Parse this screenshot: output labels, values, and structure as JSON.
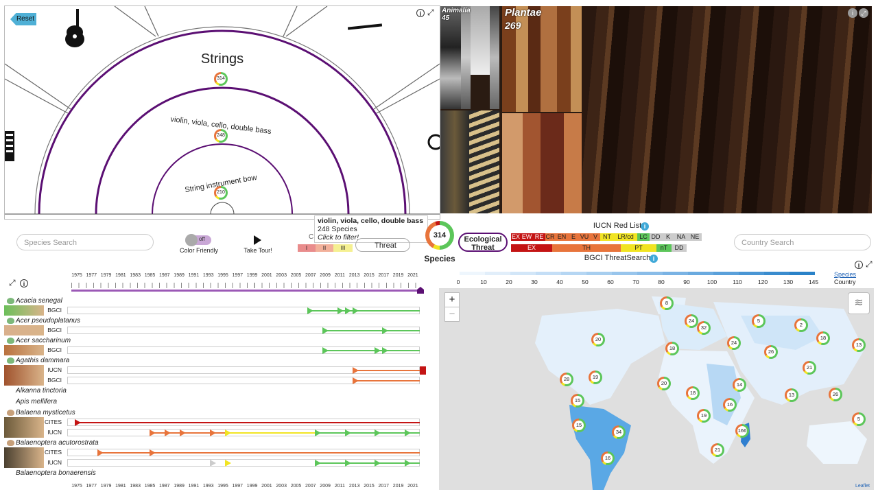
{
  "instrument_panel": {
    "reset_label": "Reset",
    "title": "Strings",
    "ring_outer_label": "violin, viola, cello, double bass",
    "ring_inner_label": "String instrument bow",
    "badge_outer": "314",
    "badge_mid": "248",
    "badge_inner": "210",
    "info_label": "i",
    "expand_label": "⤢"
  },
  "taxonomy": {
    "animalia_label": "Animalia",
    "animalia_count": "45",
    "plantae_label": "Plantae",
    "plantae_count": "269"
  },
  "tooltip": {
    "title": "violin, viola, cello, double bass",
    "count": "248 Species",
    "hint": "Click to filter!"
  },
  "controls": {
    "species_search_placeholder": "Species Search",
    "country_search_placeholder": "Country Search",
    "toggle_label": "off",
    "color_friendly_label": "Color Friendly",
    "take_tour_label": "Take Tour!",
    "threat_label": "Threat",
    "c_label": "C",
    "cites_cells": [
      "I",
      "II",
      "III"
    ],
    "species_total": "314",
    "species_label": "Species",
    "ecological_threat_label": "Ecological Threat",
    "iucn_title": "IUCN Red List",
    "bgci_title": "BGCI ThreatSearch",
    "iucn_cells": [
      {
        "t": "EX",
        "c": "#c41414"
      },
      {
        "t": "EW",
        "c": "#c41414"
      },
      {
        "t": "RE",
        "c": "#c41414"
      },
      {
        "t": "CR",
        "c": "#e8743b"
      },
      {
        "t": "EN",
        "c": "#e8743b"
      },
      {
        "t": "E",
        "c": "#e8743b"
      },
      {
        "t": "VU",
        "c": "#e8743b"
      },
      {
        "t": "V",
        "c": "#e8743b"
      },
      {
        "t": "NT",
        "c": "#f1e422"
      },
      {
        "t": "LR/cd",
        "c": "#f1e422"
      },
      {
        "t": "LC",
        "c": "#5cc65a"
      },
      {
        "t": "DD",
        "c": "#ccc"
      },
      {
        "t": "K",
        "c": "#ccc"
      },
      {
        "t": "NA",
        "c": "#ccc"
      },
      {
        "t": "NE",
        "c": "#ccc"
      }
    ],
    "bgci_cells": [
      {
        "t": "EX",
        "c": "#c41414"
      },
      {
        "t": "TH",
        "c": "#e8743b"
      },
      {
        "t": "PT",
        "c": "#f1e422"
      },
      {
        "t": "nT",
        "c": "#5cc65a"
      },
      {
        "t": "DD",
        "c": "#ccc"
      }
    ]
  },
  "map_legend": {
    "ticks": [
      "0",
      "10",
      "20",
      "30",
      "40",
      "50",
      "60",
      "70",
      "80",
      "90",
      "100",
      "110",
      "120",
      "130",
      "145"
    ],
    "species_label": "Species",
    "country_label": "Country",
    "attribution": "Leaflet",
    "zoom_in": "+",
    "zoom_out": "−"
  },
  "map_clusters": [
    {
      "n": "8"
    },
    {
      "n": "24"
    },
    {
      "n": "32"
    },
    {
      "n": "5"
    },
    {
      "n": "2"
    },
    {
      "n": "20"
    },
    {
      "n": "18"
    },
    {
      "n": "13"
    },
    {
      "n": "24"
    },
    {
      "n": "18"
    },
    {
      "n": "26"
    },
    {
      "n": "21"
    },
    {
      "n": "28"
    },
    {
      "n": "19"
    },
    {
      "n": "20"
    },
    {
      "n": "18"
    },
    {
      "n": "14"
    },
    {
      "n": "13"
    },
    {
      "n": "26"
    },
    {
      "n": "15"
    },
    {
      "n": "16"
    },
    {
      "n": "19"
    },
    {
      "n": "15"
    },
    {
      "n": "34"
    },
    {
      "n": "166"
    },
    {
      "n": "5"
    },
    {
      "n": "21"
    },
    {
      "n": "16"
    }
  ],
  "timeline": {
    "years": [
      "1975",
      "1977",
      "1979",
      "1981",
      "1983",
      "1985",
      "1987",
      "1989",
      "1991",
      "1993",
      "1995",
      "1997",
      "1999",
      "2001",
      "2003",
      "2005",
      "2007",
      "2009",
      "2011",
      "2013",
      "2015",
      "2017",
      "2019",
      "2021"
    ],
    "species": [
      {
        "name": "Acacia senegal",
        "tracks": [
          "BGCI"
        ]
      },
      {
        "name": "Acer pseudoplatanus",
        "tracks": [
          "BGCI"
        ]
      },
      {
        "name": "Acer saccharinum",
        "tracks": [
          "BGCI"
        ]
      },
      {
        "name": "Agathis dammara",
        "tracks": [
          "IUCN",
          "BGCI"
        ]
      },
      {
        "name": "Alkanna tinctoria",
        "tracks": []
      },
      {
        "name": "Apis mellifera",
        "tracks": []
      },
      {
        "name": "Balaena mysticetus",
        "tracks": [
          "CITES",
          "IUCN"
        ]
      },
      {
        "name": "Balaenoptera acutorostrata",
        "tracks": [
          "CITES",
          "IUCN"
        ]
      },
      {
        "name": "Balaenoptera bonaerensis",
        "tracks": []
      }
    ]
  }
}
